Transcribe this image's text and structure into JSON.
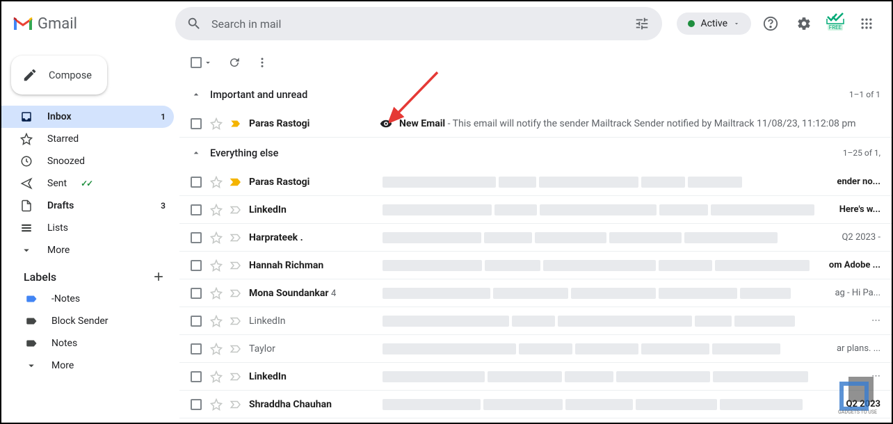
{
  "app": {
    "name": "Gmail"
  },
  "search": {
    "placeholder": "Search in mail"
  },
  "status": {
    "label": "Active"
  },
  "compose": {
    "label": "Compose"
  },
  "nav": {
    "items": [
      {
        "label": "Inbox",
        "count": "1",
        "bold": true,
        "active": true
      },
      {
        "label": "Starred"
      },
      {
        "label": "Snoozed"
      },
      {
        "label": "Sent"
      },
      {
        "label": "Drafts",
        "count": "3",
        "bold": true
      },
      {
        "label": "Lists"
      },
      {
        "label": "More"
      }
    ]
  },
  "labels": {
    "header": "Labels",
    "items": [
      {
        "label": "-Notes"
      },
      {
        "label": "Block Sender"
      },
      {
        "label": "Notes"
      },
      {
        "label": "More"
      }
    ]
  },
  "sections": {
    "important": {
      "title": "Important and unread",
      "count": "1–1 of 1"
    },
    "everything": {
      "title": "Everything else",
      "count": "1–25 of 1,"
    }
  },
  "important_rows": [
    {
      "sender": "Paras Rastogi",
      "subject": "New Email",
      "preview": " - This email will notify the sender Mailtrack Sender notified by Mailtrack 11/08/23, 11:12:08 pm"
    }
  ],
  "rows": [
    {
      "sender": "Paras Rastogi",
      "tail": "ender no..."
    },
    {
      "sender": "LinkedIn",
      "tail": "Here's w..."
    },
    {
      "sender": "Harprateek .",
      "tail": "Q2 2023",
      "taildash": " - "
    },
    {
      "sender": "Hannah Richman",
      "tail": "om Adobe ..."
    },
    {
      "sender": "Mona Soundankar",
      "thread": "4",
      "tail": "ag",
      "taildash": " - Hi Pa..."
    },
    {
      "sender": "LinkedIn",
      "unread": false,
      "tail": "...",
      "ellipsis": true
    },
    {
      "sender": "Taylor",
      "unread": false,
      "tail": "ar plans. ..."
    },
    {
      "sender": "LinkedIn",
      "tail": "...",
      "ellipsis": true
    },
    {
      "sender": "Shraddha Chauhan",
      "tail": "Q2 2023"
    }
  ],
  "mailtrack": {
    "free": "FREE"
  },
  "watermark": "GADGETS TO USE"
}
